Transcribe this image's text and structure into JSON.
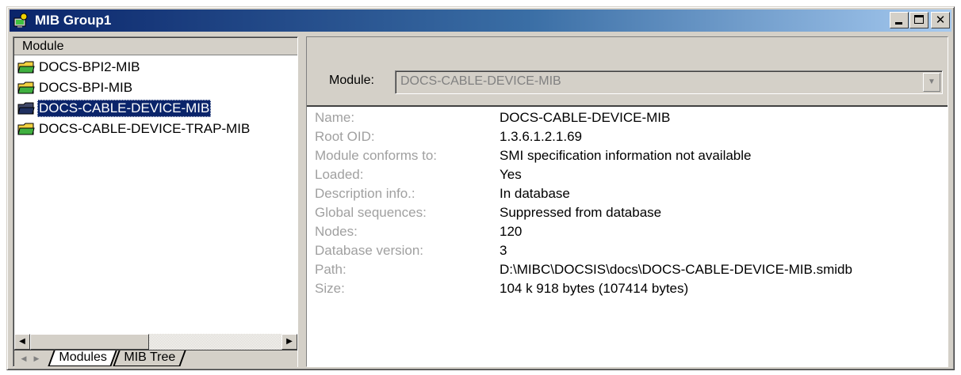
{
  "window": {
    "title": "MIB Group1",
    "icon": "mib-group-icon",
    "buttons": {
      "minimize": "minimize-icon",
      "maximize": "maximize-icon",
      "close_glyph": "✕"
    }
  },
  "left_pane": {
    "header": "Module",
    "items": [
      {
        "label": "DOCS-BPI2-MIB",
        "icon": "folder-icon",
        "selected": false
      },
      {
        "label": "DOCS-BPI-MIB",
        "icon": "folder-icon",
        "selected": false
      },
      {
        "label": "DOCS-CABLE-DEVICE-MIB",
        "icon": "folder-icon",
        "selected": true
      },
      {
        "label": "DOCS-CABLE-DEVICE-TRAP-MIB",
        "icon": "folder-icon",
        "selected": false
      }
    ],
    "tabs": [
      {
        "label": "Modules",
        "active": true
      },
      {
        "label": "MIB Tree",
        "active": false
      }
    ]
  },
  "right_pane": {
    "module_caption": "Module:",
    "module_value": "DOCS-CABLE-DEVICE-MIB",
    "details": [
      {
        "label": "Name:",
        "value": "DOCS-CABLE-DEVICE-MIB"
      },
      {
        "label": "Root OID:",
        "value": "1.3.6.1.2.1.69"
      },
      {
        "label": "Module conforms to:",
        "value": "SMI specification information not available"
      },
      {
        "label": "Loaded:",
        "value": "Yes"
      },
      {
        "label": "Description info.:",
        "value": "In database"
      },
      {
        "label": "Global sequences:",
        "value": "Suppressed from database"
      },
      {
        "label": "Nodes:",
        "value": "120"
      },
      {
        "label": "Database version:",
        "value": "3"
      },
      {
        "label": "Path:",
        "value": "D:\\MIBC\\DOCSIS\\docs\\DOCS-CABLE-DEVICE-MIB.smidb"
      },
      {
        "label": "Size:",
        "value": "104 k 918 bytes (107414 bytes)"
      }
    ]
  },
  "colors": {
    "title_bar_start": "#0a246a",
    "title_bar_end": "#a6caf0",
    "selection": "#0a246a",
    "face": "#d4d0c8",
    "label_gray": "#a0a0a0"
  }
}
